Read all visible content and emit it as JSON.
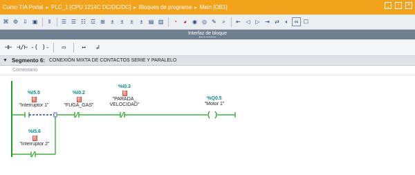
{
  "titlebar": {
    "crumbs": [
      "Curso TIA Portal",
      "PLC_1 [CPU 1214C DC/DC/DC]",
      "Bloques de programa",
      "Main [OB1]"
    ],
    "separator": "▸"
  },
  "toolbar1": {
    "icons": [
      "network-icon",
      "compile-icon",
      "download-icon",
      "monitor-icon",
      "pause-icon",
      "list-icon",
      "list-icon",
      "list-icon",
      "list-icon",
      "insert-icon",
      "net-add-icon",
      "net-remove-icon",
      "net-expand-icon",
      "net-collapse-icon",
      "absolute-icon",
      "comment-icon",
      "go-online-icon",
      "go-offline-icon",
      "watch-icon",
      "watch-all-icon",
      "modify-icon",
      "search-icon",
      "replace-icon",
      "first-icon",
      "back-icon",
      "forward-icon",
      "last-icon",
      "monitor-on-icon"
    ]
  },
  "interface_bar": {
    "label": "Interfaz de bloque"
  },
  "lad_toolbar": {
    "items": [
      {
        "name": "no-contact-icon",
        "glyph": "⊣⊢"
      },
      {
        "name": "nc-contact-icon",
        "glyph": "⊣/⊢"
      },
      {
        "name": "coil-icon",
        "glyph": "-( )-"
      },
      {
        "name": "empty-box-icon",
        "glyph": "▭"
      },
      {
        "name": "open-branch-icon",
        "glyph": "↦"
      },
      {
        "name": "close-branch-icon",
        "glyph": "↲"
      }
    ]
  },
  "segment": {
    "title": "Segmento 6:",
    "description": "CONEXIÓN MIXTA DE CONTACTOS SERIE Y PARALELO",
    "comment_placeholder": "Comentario"
  },
  "operands": [
    {
      "id": "i55",
      "address": "%I5.5",
      "badge": "F",
      "name": "\"Interruptor 1\""
    },
    {
      "id": "i02",
      "address": "%I0.2",
      "badge": "F",
      "name": "\"FUGA_GAS\""
    },
    {
      "id": "i03",
      "address": "%I0.3",
      "badge": "F",
      "name_line1": "\"PARADA_",
      "name_line2": "VELOCIDAD\""
    },
    {
      "id": "q05",
      "address": "%Q0.5",
      "badge": "F",
      "name": "\"Motor 1\""
    },
    {
      "id": "i56",
      "address": "%I5.6",
      "badge": "F",
      "name": "\"Interruptor 2\""
    }
  ],
  "colors": {
    "titlebar": "#f3a21c",
    "power_rail": "#1aa01a",
    "operand_address": "#0a8a8a",
    "badge": "#f08c7c",
    "branch_highlight": "#2a3fb0"
  }
}
